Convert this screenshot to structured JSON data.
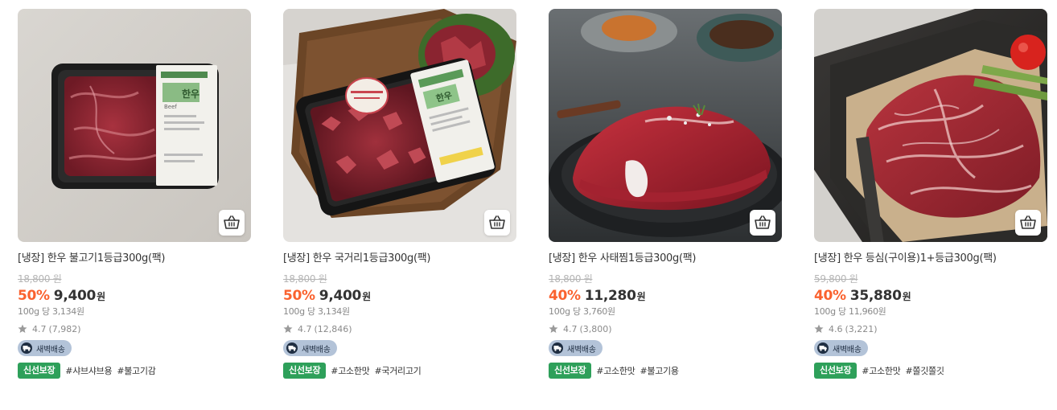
{
  "products": [
    {
      "image_subject": "packaged-hanwoo-bulgogi",
      "title": "[냉장] 한우 불고기1등급300g(팩)",
      "original_price": "18,800 원",
      "discount_rate": "50%",
      "price": "9,400",
      "currency": "원",
      "unit_price": "100g 당 3,134원",
      "rating": "4.7",
      "reviews": "(7,982)",
      "delivery": "새벽배송",
      "badge": "신선보장",
      "tags": [
        "#샤브샤브용",
        "#불고기감"
      ],
      "package_label": "한우",
      "package_sub": "Beef"
    },
    {
      "image_subject": "packaged-hanwoo-soup-cubes",
      "title": "[냉장] 한우 국거리1등급300g(팩)",
      "original_price": "18,800 원",
      "discount_rate": "50%",
      "price": "9,400",
      "currency": "원",
      "unit_price": "100g 당 3,134원",
      "rating": "4.7",
      "reviews": "(12,846)",
      "delivery": "새벽배송",
      "badge": "신선보장",
      "tags": [
        "#고소한맛",
        "#국거리고기"
      ],
      "package_label": "한우"
    },
    {
      "image_subject": "hanwoo-brisket-on-plate",
      "title": "[냉장] 한우 사태찜1등급300g(팩)",
      "original_price": "18,800 원",
      "discount_rate": "40%",
      "price": "11,280",
      "currency": "원",
      "unit_price": "100g 당 3,760원",
      "rating": "4.7",
      "reviews": "(3,800)",
      "delivery": "새벽배송",
      "badge": "신선보장",
      "tags": [
        "#고소한맛",
        "#불고기용"
      ]
    },
    {
      "image_subject": "hanwoo-sirloin-on-tray",
      "title": "[냉장] 한우 등심(구이용)1+등급300g(팩)",
      "original_price": "59,800 원",
      "discount_rate": "40%",
      "price": "35,880",
      "currency": "원",
      "unit_price": "100g 당 11,960원",
      "rating": "4.6",
      "reviews": "(3,221)",
      "delivery": "새벽배송",
      "badge": "신선보장",
      "tags": [
        "#고소한맛",
        "#쫄깃쫄깃"
      ]
    }
  ],
  "icons": {
    "cart": "shopping-basket-icon",
    "star": "star-icon",
    "delivery": "truck-icon"
  },
  "colors": {
    "discount": "#fa622f",
    "fresh_badge": "#2ea05a",
    "dawn_badge": "#b3c3d8",
    "text": "#333333",
    "muted": "#888888"
  }
}
